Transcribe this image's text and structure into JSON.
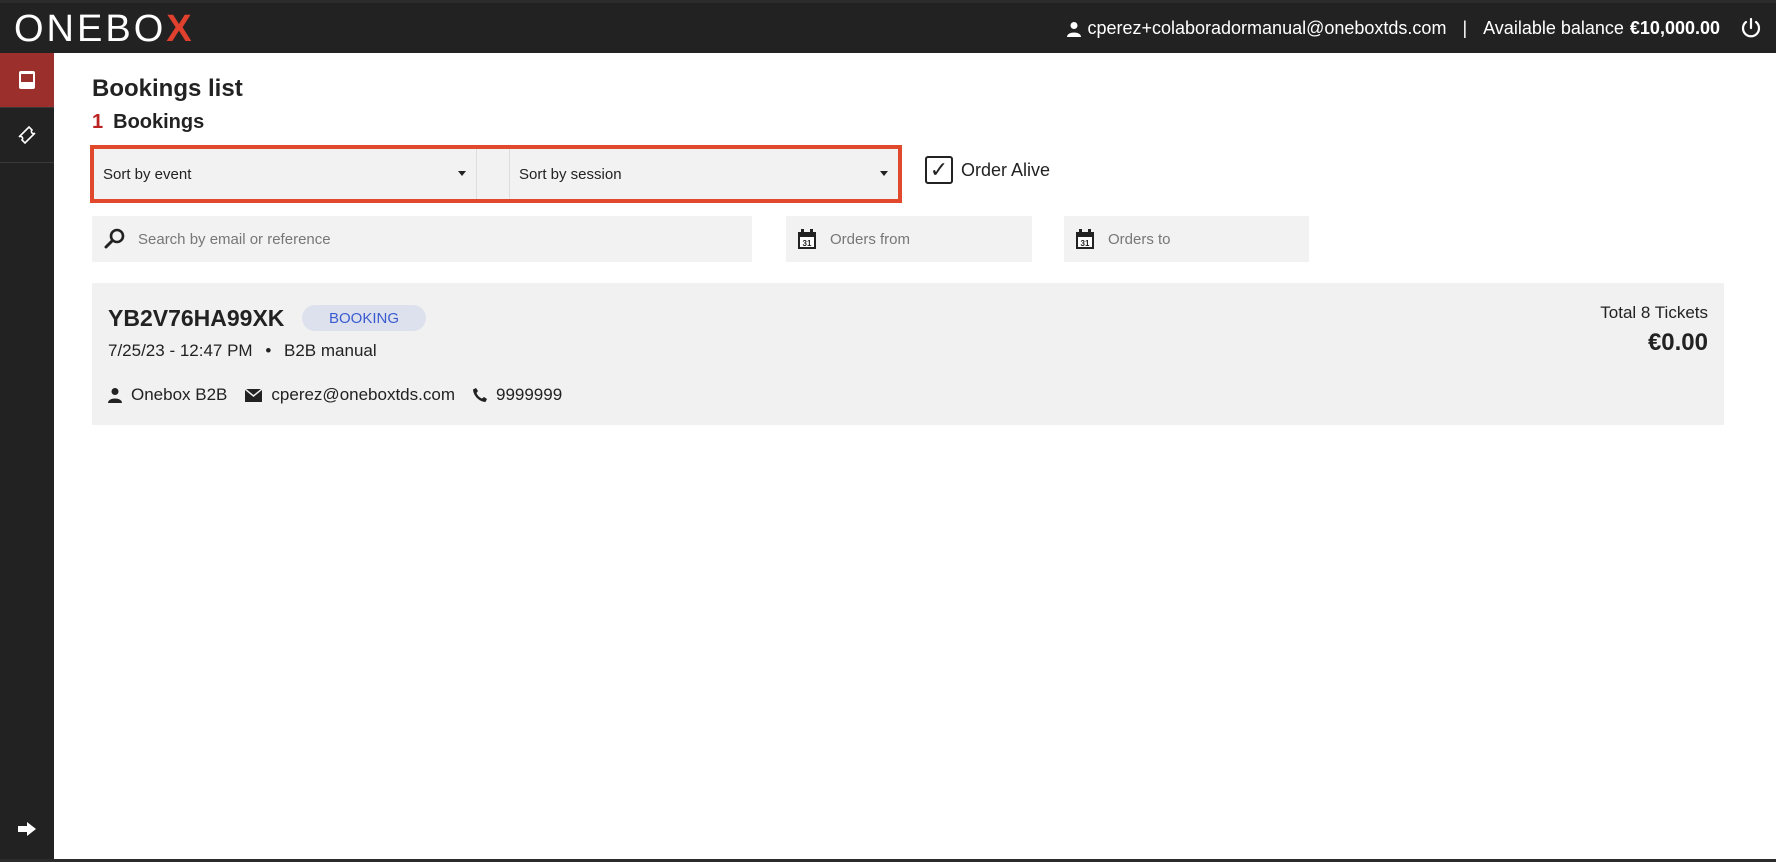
{
  "header": {
    "logo_text": "ONEBO",
    "logo_x": "X",
    "user_email": "cperez+colaboradormanual@oneboxtds.com",
    "separator": "|",
    "balance_label": "Available balance",
    "balance_value": "€10,000.00"
  },
  "sidebar": {
    "items": [
      {
        "icon": "book-icon",
        "active": true
      },
      {
        "icon": "ticket-icon",
        "active": false
      }
    ],
    "bottom_icon": "arrow-right-icon"
  },
  "page": {
    "title": "Bookings list",
    "count": "1",
    "count_label": "Bookings"
  },
  "filters": {
    "sort_event": "Sort by event",
    "sort_session": "Sort by session",
    "order_alive_label": "Order Alive",
    "order_alive_checked": true,
    "search_placeholder": "Search by email or reference",
    "orders_from": "Orders from",
    "orders_to": "Orders to"
  },
  "bookings": [
    {
      "reference": "YB2V76HA99XK",
      "badge": "BOOKING",
      "datetime": "7/25/23 - 12:47 PM",
      "bullet": "•",
      "channel": "B2B manual",
      "client": "Onebox B2B",
      "email": "cperez@oneboxtds.com",
      "phone": "9999999",
      "total_tickets": "Total 8 Tickets",
      "total_price": "€0.00"
    }
  ],
  "colors": {
    "accent": "#9b2f2b",
    "highlight_border": "#e0492b",
    "badge_text": "#3a5bd0",
    "badge_bg": "#dde1ee"
  }
}
